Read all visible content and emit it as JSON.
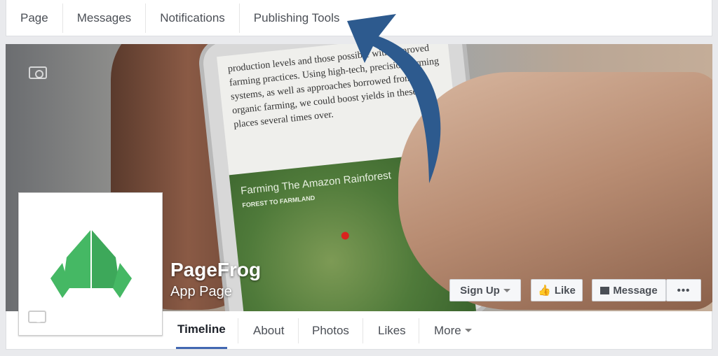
{
  "top_tabs": [
    "Page",
    "Messages",
    "Notifications",
    "Publishing Tools"
  ],
  "cover": {
    "article_text": "production levels and those possible with improved farming practices. Using high-tech, precision farming systems, as well as approaches borrowed from organic farming, we could boost yields in these places several times over.",
    "map_title": "Farming The Amazon Rainforest",
    "map_subtitle": "FOREST TO FARMLAND"
  },
  "page": {
    "name": "PageFrog",
    "type": "App Page"
  },
  "actions": {
    "signup": "Sign Up",
    "like": "Like",
    "message": "Message",
    "more": "•••"
  },
  "nav_tabs": [
    "Timeline",
    "About",
    "Photos",
    "Likes",
    "More"
  ],
  "colors": {
    "logo_green": "#45b864",
    "arrow_blue": "#2d5a8e",
    "active_tab": "#4267b2"
  }
}
